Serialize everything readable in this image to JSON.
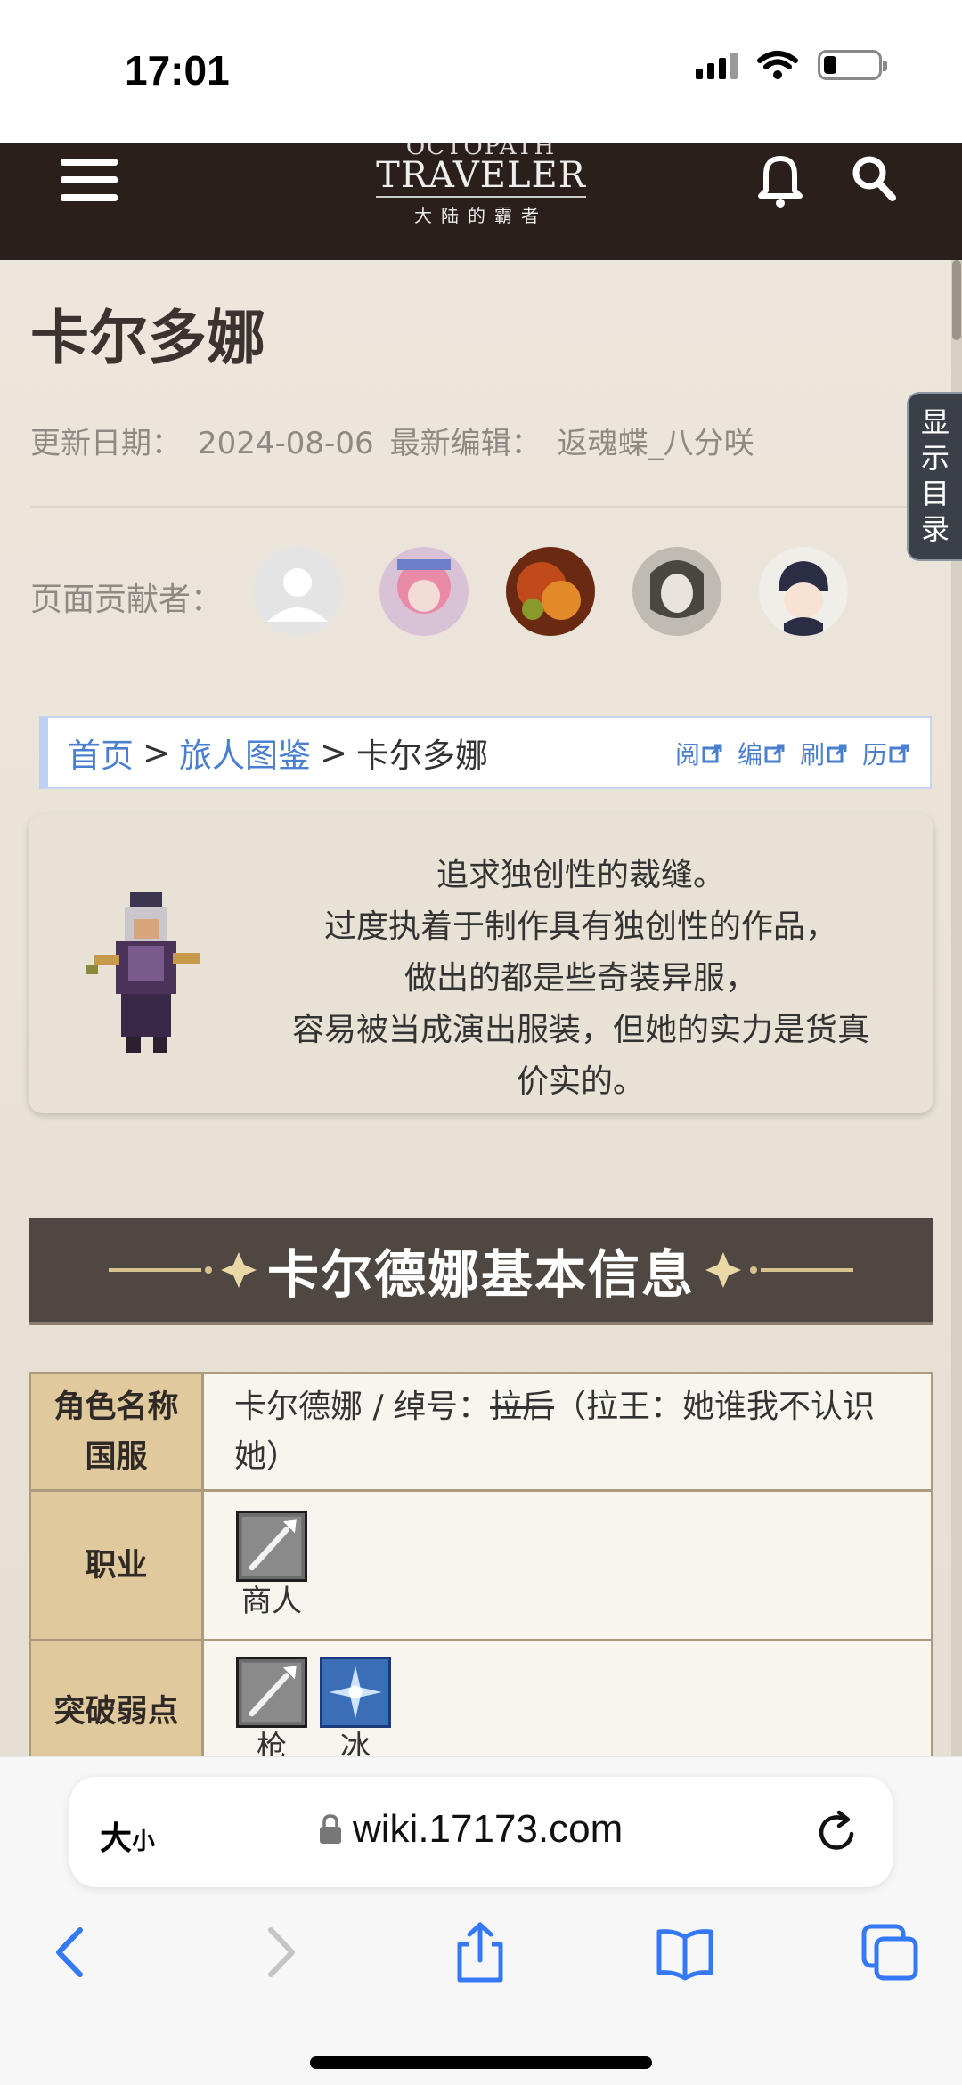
{
  "status_bar": {
    "time": "17:01"
  },
  "header": {
    "logo_line1": "OCTOPATH",
    "logo_line2": "TRAVELER",
    "logo_line3": "大陆的霸者"
  },
  "page": {
    "title": "卡尔多娜",
    "update_label": "更新日期：",
    "update_date": "2024-08-06",
    "editor_label": "最新编辑：",
    "editor_name": "返魂蝶_八分咲",
    "contributors_label": "页面贡献者：",
    "toc_label": "显示目录"
  },
  "breadcrumb": {
    "home": "首页",
    "sep": ">",
    "section": "旅人图鉴",
    "current": "卡尔多娜",
    "tools": [
      "阅",
      "编",
      "刷",
      "历"
    ]
  },
  "intro": {
    "lines": [
      "追求独创性的裁缝。",
      "过度执着于制作具有独创性的作品，",
      "做出的都是些奇装异服，",
      "容易被当成演出服装，但她的实力是货真",
      "价实的。"
    ]
  },
  "section": {
    "title": "卡尔德娜基本信息"
  },
  "info_table": {
    "row1_header_line1": "角色名称",
    "row1_header_line2": "国服",
    "row1_value_a": "卡尔德娜 / 绰号：",
    "row1_value_strike": "拉后",
    "row1_value_b": "（拉王：她谁我不认识她）",
    "row2_header": "职业",
    "row2_icon_label": "商人",
    "row3_header": "突破弱点",
    "row3_icon1_label": "枪",
    "row3_icon2_label": "冰"
  },
  "browser": {
    "text_size_label": "大",
    "text_size_small": "小",
    "url": "wiki.17173.com"
  },
  "colors": {
    "header_bg": "#2a1f1b",
    "link": "#4a7fcf",
    "table_header": "#e0c99d",
    "banner": "#4f4742"
  }
}
